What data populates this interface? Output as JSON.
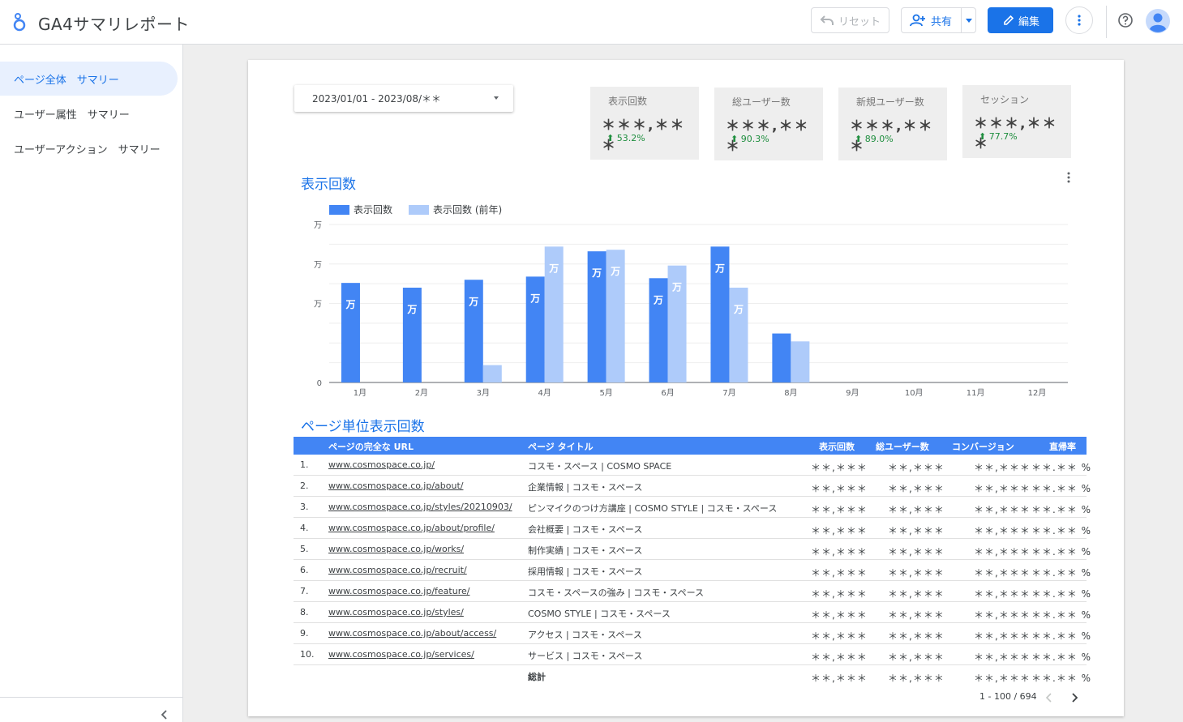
{
  "app": {
    "title": "GA4サマリレポート"
  },
  "toolbar": {
    "reset_label": "リセット",
    "share_label": "共有",
    "edit_label": "編集"
  },
  "sidebar": {
    "items": [
      {
        "label": "ページ全体　サマリー",
        "active": true
      },
      {
        "label": "ユーザー属性　サマリー",
        "active": false
      },
      {
        "label": "ユーザーアクション　サマリー",
        "active": false
      }
    ]
  },
  "date_range": "2023/01/01 - 2023/08/＊＊",
  "kpis": [
    {
      "label": "表示回数",
      "value": "＊＊＊,＊＊＊",
      "change": "53.2%"
    },
    {
      "label": "総ユーザー数",
      "value": "＊＊＊,＊＊＊",
      "change": "90.3%"
    },
    {
      "label": "新規ユーザー数",
      "value": "＊＊＊,＊＊＊",
      "change": "89.0%"
    },
    {
      "label": "セッション",
      "value": "＊＊＊,＊＊＊",
      "change": "77.7%"
    }
  ],
  "colors": {
    "accent": "#1a73e8",
    "current": "#4285f4",
    "previous": "#aecbfa",
    "positive": "#1e8e3e"
  },
  "chart_title": "表示回数",
  "chart_data": {
    "type": "bar",
    "categories": [
      "1月",
      "2月",
      "3月",
      "4月",
      "5月",
      "6月",
      "7月",
      "8月",
      "9月",
      "10月",
      "11月",
      "12月"
    ],
    "series": [
      {
        "name": "表示回数",
        "values": [
          0.63,
          0.6,
          0.65,
          0.67,
          0.83,
          0.66,
          0.86,
          0.31,
          null,
          null,
          null,
          null
        ]
      },
      {
        "name": "表示回数 (前年)",
        "values": [
          null,
          null,
          0.11,
          0.86,
          0.84,
          0.74,
          0.6,
          0.26,
          null,
          null,
          null,
          null
        ]
      }
    ],
    "bar_labels": [
      "万",
      "万",
      "万",
      "万",
      "万",
      "万",
      "万",
      null,
      null,
      null,
      null,
      null
    ],
    "prev_bar_labels": [
      null,
      null,
      null,
      "万",
      "万",
      "万",
      "万",
      null,
      null,
      null,
      null,
      null
    ],
    "y_tick_labels": [
      "0",
      "",
      "万",
      "万",
      "万"
    ],
    "ylim": [
      0,
      1
    ],
    "grid": true,
    "legend": "top-left"
  },
  "table_title": "ページ単位表示回数",
  "table": {
    "columns": [
      "ページの完全な URL",
      "ページ タイトル",
      "表示回数",
      "総ユーザー数",
      "コンバージョン",
      "直帰率"
    ],
    "rows": [
      {
        "n": "1.",
        "url": "www.cosmospace.co.jp/",
        "title": "コスモ・スペース | COSMO SPACE"
      },
      {
        "n": "2.",
        "url": "www.cosmospace.co.jp/about/",
        "title": "企業情報 | コスモ・スペース"
      },
      {
        "n": "3.",
        "url": "www.cosmospace.co.jp/styles/20210903/",
        "title": "ピンマイクのつけ方講座 | COSMO STYLE | コスモ・スペース"
      },
      {
        "n": "4.",
        "url": "www.cosmospace.co.jp/about/profile/",
        "title": "会社概要 | コスモ・スペース"
      },
      {
        "n": "5.",
        "url": "www.cosmospace.co.jp/works/",
        "title": "制作実績 | コスモ・スペース"
      },
      {
        "n": "6.",
        "url": "www.cosmospace.co.jp/recruit/",
        "title": "採用情報 | コスモ・スペース"
      },
      {
        "n": "7.",
        "url": "www.cosmospace.co.jp/feature/",
        "title": "コスモ・スペースの強み | コスモ・スペース"
      },
      {
        "n": "8.",
        "url": "www.cosmospace.co.jp/styles/",
        "title": "COSMO STYLE | コスモ・スペース"
      },
      {
        "n": "9.",
        "url": "www.cosmospace.co.jp/about/access/",
        "title": "アクセス | コスモ・スペース"
      },
      {
        "n": "10.",
        "url": "www.cosmospace.co.jp/services/",
        "title": "サービス | コスモ・スペース"
      }
    ],
    "masked": {
      "views": "＊＊,＊＊＊",
      "users": "＊＊,＊＊＊",
      "conv": "＊＊,＊＊＊",
      "bounce": "＊＊.＊＊ %"
    },
    "total_label": "総計",
    "pagination": "1 - 100 / 694"
  }
}
